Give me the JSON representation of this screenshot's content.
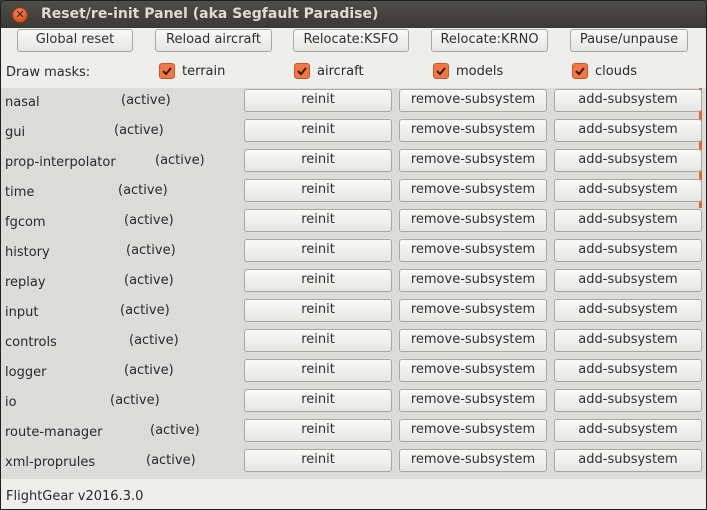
{
  "window": {
    "title": "Reset/re-init Panel (aka Segfault Paradise)",
    "close_icon": "close-icon",
    "accent_color": "#f07746"
  },
  "toolbar": {
    "global_reset": "Global reset",
    "reload_aircraft": "Reload aircraft",
    "relocate_ksfo": "Relocate:KSFO",
    "relocate_krno": "Relocate:KRNO",
    "pause_unpause": "Pause/unpause"
  },
  "masks": {
    "label": "Draw masks:",
    "items": [
      {
        "label": "terrain",
        "checked": true
      },
      {
        "label": "aircraft",
        "checked": true
      },
      {
        "label": "models",
        "checked": true
      },
      {
        "label": "clouds",
        "checked": true
      }
    ]
  },
  "subsystem_buttons": {
    "reinit": "reinit",
    "remove": "remove-subsystem",
    "add": "add-subsystem"
  },
  "subsystems": [
    {
      "name": "nasal",
      "status": "(active)"
    },
    {
      "name": "gui",
      "status": "(active)"
    },
    {
      "name": "prop-interpolator",
      "status": "(active)"
    },
    {
      "name": "time",
      "status": "(active)"
    },
    {
      "name": "fgcom",
      "status": "(active)"
    },
    {
      "name": "history",
      "status": "(active)"
    },
    {
      "name": "replay",
      "status": "(active)"
    },
    {
      "name": "input",
      "status": "(active)"
    },
    {
      "name": "controls",
      "status": "(active)"
    },
    {
      "name": "logger",
      "status": "(active)"
    },
    {
      "name": "io",
      "status": "(active)"
    },
    {
      "name": "route-manager",
      "status": "(active)"
    },
    {
      "name": "xml-proprules",
      "status": "(active)"
    }
  ],
  "footer": {
    "version": "FlightGear v2016.3.0"
  }
}
